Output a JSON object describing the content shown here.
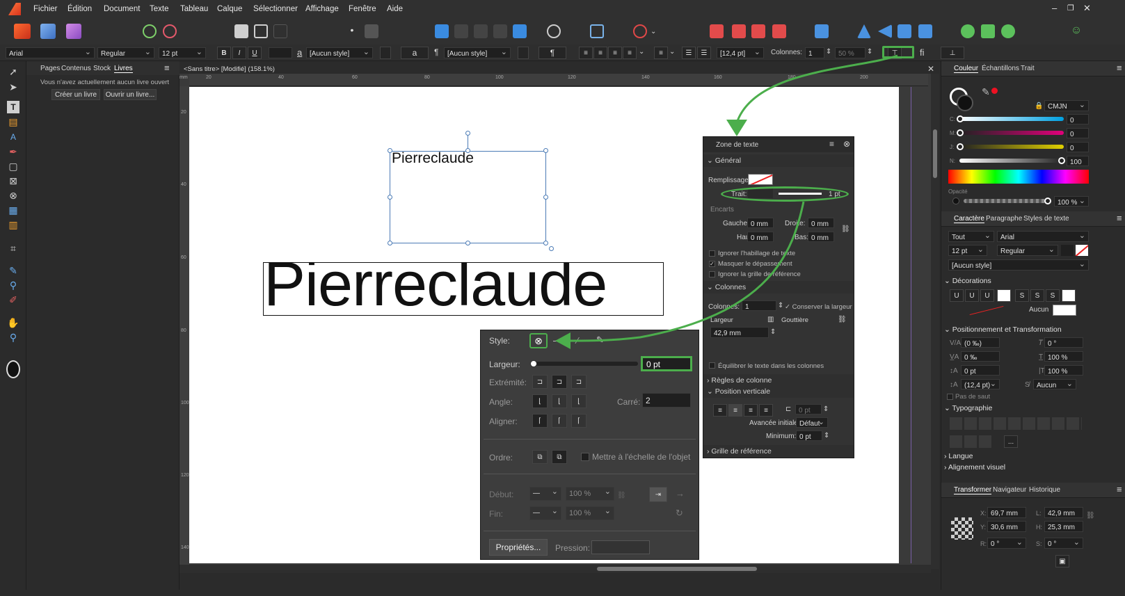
{
  "menu": [
    "Fichier",
    "Édition",
    "Document",
    "Texte",
    "Tableau",
    "Calque",
    "Sélectionner",
    "Affichage",
    "Fenêtre",
    "Aide"
  ],
  "context_bar": {
    "font": "Arial",
    "weight": "Regular",
    "size": "12 pt",
    "bold": "B",
    "italic": "I",
    "underline": "U",
    "char_style": "[Aucun style]",
    "para_style": "[Aucun style]",
    "leading": "[12,4 pt]",
    "columns_label": "Colonnes:",
    "columns_value": "1",
    "percent": "50 %",
    "fi": "fi"
  },
  "left_panel": {
    "tabs": [
      "Pages",
      "Contenus",
      "Stock",
      "Livres"
    ],
    "active_tab": "Livres",
    "message": "Vous n'avez actuellement aucun livre ouvert",
    "create_book": "Créer un livre",
    "open_book": "Ouvrir un livre..."
  },
  "document": {
    "tab_title": "<Sans titre> [Modifié] (158.1%)",
    "ruler_unit": "mm",
    "ruler_h": [
      "20",
      "40",
      "60",
      "80",
      "100",
      "120",
      "140",
      "160",
      "180",
      "200"
    ],
    "ruler_v": [
      "20",
      "40",
      "60",
      "80",
      "100",
      "120",
      "140"
    ],
    "textframe_text": "Pierreclaude",
    "artistic_text": "Pierreclaude"
  },
  "text_frame_panel": {
    "title": "Zone de texte",
    "general": "Général",
    "fill_label": "Remplissage:",
    "stroke_label": "Trait:",
    "stroke_value": "1 pt",
    "insets": "Encarts",
    "left_label": "Gauche:",
    "left_value": "0 mm",
    "right_label": "Droite:",
    "right_value": "0 mm",
    "top_label": "Haut:",
    "top_value": "0 mm",
    "bottom_label": "Bas:",
    "bottom_value": "0 mm",
    "ignore_wrap": "Ignorer l'habillage de texte",
    "hide_overflow": "Masquer le dépassement",
    "ignore_grid": "Ignorer la grille de référence",
    "columns_section": "Colonnes",
    "columns_label": "Colonnes:",
    "columns_value": "1",
    "keep_width": "Conserver la largeur",
    "width_label": "Largeur",
    "gutter_label": "Gouttière",
    "width_value": "42,9 mm",
    "balance": "Équilibrer le texte dans les colonnes",
    "column_rules": "Règles de colonne",
    "vertical_position": "Position verticale",
    "vp_value": "0 pt",
    "initial_advance_label": "Avancée initiale:",
    "initial_advance_value": "Défaut",
    "minimum_label": "Minimum:",
    "minimum_value": "0 pt",
    "baseline_grid": "Grille de référence"
  },
  "stroke_popup": {
    "style_label": "Style:",
    "width_label": "Largeur:",
    "width_value": "0 pt",
    "cap_label": "Extrémité:",
    "join_label": "Angle:",
    "miter_label": "Carré:",
    "miter_value": "2",
    "align_label": "Aligner:",
    "order_label": "Ordre:",
    "scale_label": "Mettre à l'échelle de l'objet",
    "start_label": "Début:",
    "start_pct": "100 %",
    "end_label": "Fin:",
    "end_pct": "100 %",
    "properties": "Propriétés...",
    "pressure_label": "Pression:"
  },
  "right_panel": {
    "color_tabs": [
      "Couleur",
      "Échantillons",
      "Trait"
    ],
    "color_mode": "CMJN",
    "c_label": "C:",
    "c_value": "0",
    "m_label": "M:",
    "m_value": "0",
    "j_label": "J:",
    "j_value": "0",
    "n_label": "N:",
    "n_value": "100",
    "opacity_label": "Opacité",
    "opacity_value": "100 %",
    "char_tabs": [
      "Caractère",
      "Paragraphe",
      "Styles de texte"
    ],
    "scope": "Tout",
    "font": "Arial",
    "size": "12 pt",
    "weight": "Regular",
    "style": "[Aucun style]",
    "decorations": "Décorations",
    "deco_none": "Aucun",
    "pos_transform": "Positionnement et Transformation",
    "kerning": "(0 ‰)",
    "shear": "0 °",
    "tracking": "0 ‰",
    "vscale": "100 %",
    "baseline": "0 pt",
    "hscale": "100 %",
    "leading": "(12,4 pt)",
    "no_break_sel": "Aucun",
    "no_break": "Pas de saut",
    "typography": "Typographie",
    "language": "Langue",
    "visual_align": "Alignement visuel",
    "transform_tabs": [
      "Transformer",
      "Navigateur",
      "Historique"
    ],
    "x_label": "X:",
    "x_value": "69,7 mm",
    "y_label": "Y:",
    "y_value": "30,6 mm",
    "w_label": "L:",
    "w_value": "42,9 mm",
    "h_label": "H:",
    "h_value": "25,3 mm",
    "r_label": "R:",
    "r_value": "0 °",
    "s_label": "S:",
    "s_value": "0 °"
  },
  "colors": {
    "accent_green": "#4cae4c",
    "app_bg": "#2b2b2b",
    "selection_blue": "#4a7ab5"
  }
}
